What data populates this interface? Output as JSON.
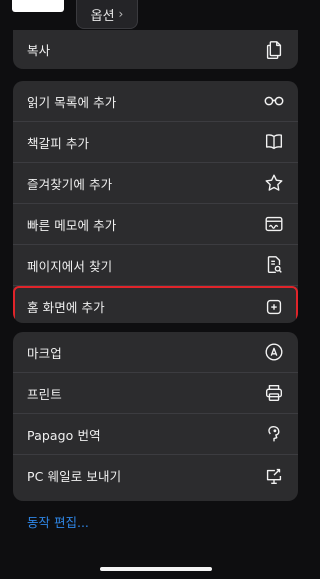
{
  "top": {
    "options_label": "옵션",
    "options_chevron": "›"
  },
  "menu": {
    "copy": {
      "label": "복사",
      "icon": "copy-icon"
    },
    "section1": [
      {
        "label": "읽기 목록에 추가",
        "icon": "glasses-icon"
      },
      {
        "label": "책갈피 추가",
        "icon": "book-icon"
      },
      {
        "label": "즐겨찾기에 추가",
        "icon": "star-icon"
      },
      {
        "label": "빠른 메모에 추가",
        "icon": "quick-note-icon"
      },
      {
        "label": "페이지에서 찾기",
        "icon": "find-in-page-icon"
      },
      {
        "label": "홈 화면에 추가",
        "icon": "add-square-icon",
        "highlighted": true
      }
    ],
    "section2": [
      {
        "label": "마크업",
        "icon": "markup-icon"
      },
      {
        "label": "프린트",
        "icon": "printer-icon"
      },
      {
        "label": "Papago 번역",
        "icon": "papago-icon"
      },
      {
        "label": "PC 웨일로 보내기",
        "icon": "whale-send-icon"
      }
    ],
    "edit_actions": "동작 편집..."
  },
  "colors": {
    "background": "#0e0e10",
    "card": "#2c2c2e",
    "link": "#2f86e6",
    "highlight": "#e0242a"
  }
}
